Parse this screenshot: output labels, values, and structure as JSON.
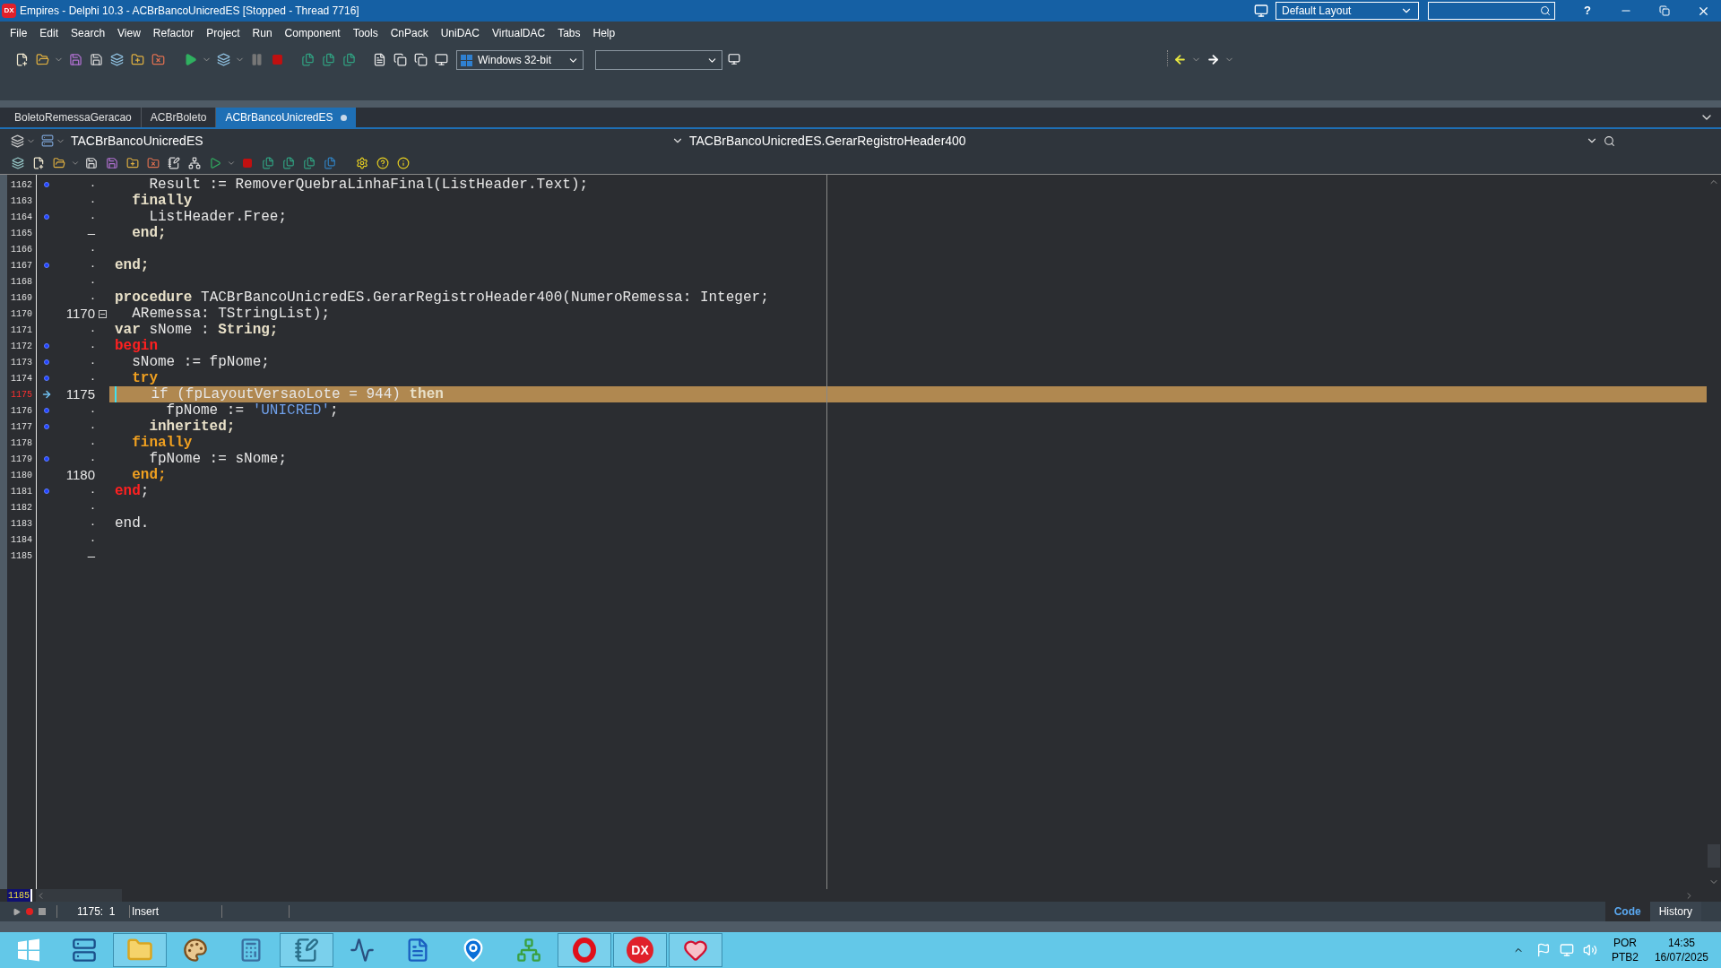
{
  "window": {
    "logo": "DX",
    "title": "Empires - Delphi 10.3 - ACBrBancoUnicredES [Stopped - Thread 7716]",
    "layout": "Default Layout",
    "help": "?"
  },
  "menu": [
    "File",
    "Edit",
    "Search",
    "View",
    "Refactor",
    "Project",
    "Run",
    "Component",
    "Tools",
    "CnPack",
    "UniDAC",
    "VirtualDAC",
    "Tabs",
    "Help"
  ],
  "toolbar": {
    "platform": "Windows 32-bit"
  },
  "tabs": [
    {
      "label": "BoletoRemessaGeracao",
      "selected": false,
      "modified": false
    },
    {
      "label": "ACBrBoleto",
      "selected": false,
      "modified": false
    },
    {
      "label": "ACBrBancoUnicredES",
      "selected": true,
      "modified": true
    }
  ],
  "editor": {
    "unit": "TACBrBancoUnicredES",
    "method": "TACBrBancoUnicredES.GerarRegistroHeader400",
    "lines": [
      {
        "number": "1162",
        "marker": "·",
        "dot": true,
        "fold": false,
        "current": false,
        "tokens": [
          {
            "t": "    Result := RemoverQuebraLinhaFinal(ListHeader.Text);",
            "kind": "text"
          }
        ]
      },
      {
        "number": "1163",
        "marker": "·",
        "dot": false,
        "fold": false,
        "current": false,
        "tokens": [
          {
            "t": "  finally",
            "kind": "kw"
          }
        ]
      },
      {
        "number": "1164",
        "marker": "·",
        "dot": true,
        "fold": false,
        "current": false,
        "tokens": [
          {
            "t": "    ListHeader.Free;",
            "kind": "text"
          }
        ]
      },
      {
        "number": "1165",
        "marker": "–",
        "dot": false,
        "fold": false,
        "current": false,
        "tokens": [
          {
            "t": "  end;",
            "kind": "kw"
          }
        ]
      },
      {
        "number": "1166",
        "marker": "·",
        "dot": false,
        "fold": false,
        "current": false
      },
      {
        "number": "1167",
        "marker": "·",
        "dot": true,
        "fold": false,
        "current": false,
        "tokens": [
          {
            "t": "end;",
            "kind": "kw"
          }
        ]
      },
      {
        "number": "1168",
        "marker": "·",
        "dot": false,
        "fold": false,
        "current": false
      },
      {
        "number": "1169",
        "marker": "·",
        "dot": false,
        "fold": false,
        "current": false,
        "tokens": [
          {
            "t": "procedure",
            "kind": "kw"
          },
          {
            "t": " TACBrBancoUnicredES.GerarRegistroHeader400(NumeroRemessa: Integer;",
            "kind": "text"
          }
        ]
      },
      {
        "number": "1170",
        "marker": "1170",
        "dot": false,
        "fold": true,
        "current": false,
        "tokens": [
          {
            "t": "  ARemessa: TStringList);",
            "kind": "text"
          }
        ]
      },
      {
        "number": "1171",
        "marker": "·",
        "dot": false,
        "fold": false,
        "current": false,
        "tokens": [
          {
            "t": "var",
            "kind": "kw"
          },
          {
            "t": " sNome : ",
            "kind": "text"
          },
          {
            "t": "String;",
            "kind": "kw"
          }
        ]
      },
      {
        "number": "1172",
        "marker": "·",
        "dot": true,
        "fold": false,
        "current": false,
        "tokens": [
          {
            "t": "begin",
            "kind": "kw_red"
          }
        ]
      },
      {
        "number": "1173",
        "marker": "·",
        "dot": true,
        "fold": false,
        "current": false,
        "tokens": [
          {
            "t": "  sNome := fpNome;",
            "kind": "text"
          }
        ]
      },
      {
        "number": "1174",
        "marker": "·",
        "dot": true,
        "fold": false,
        "current": false,
        "tokens": [
          {
            "t": "  try",
            "kind": "kw_orange"
          }
        ]
      },
      {
        "number": "1175",
        "marker": "1175",
        "dot": false,
        "fold": false,
        "current": true,
        "tokens": [
          {
            "t": "    if (fpLayoutVersaoLote = 944) ",
            "kind": "text"
          },
          {
            "t": "then",
            "kind": "kw"
          }
        ]
      },
      {
        "number": "1176",
        "marker": "·",
        "dot": true,
        "fold": false,
        "current": false,
        "tokens": [
          {
            "t": "      fpNome := ",
            "kind": "text"
          },
          {
            "t": "'UNICRED'",
            "kind": "string"
          },
          {
            "t": ";",
            "kind": "text"
          }
        ]
      },
      {
        "number": "1177",
        "marker": "·",
        "dot": true,
        "fold": false,
        "current": false,
        "tokens": [
          {
            "t": "    inherited;",
            "kind": "kw"
          }
        ]
      },
      {
        "number": "1178",
        "marker": "·",
        "dot": false,
        "fold": false,
        "current": false,
        "tokens": [
          {
            "t": "  finally",
            "kind": "kw_orange"
          }
        ]
      },
      {
        "number": "1179",
        "marker": "·",
        "dot": true,
        "fold": false,
        "current": false,
        "tokens": [
          {
            "t": "    fpNome := sNome;",
            "kind": "text"
          }
        ]
      },
      {
        "number": "1180",
        "marker": "1180",
        "dot": false,
        "fold": false,
        "current": false,
        "tokens": [
          {
            "t": "  end;",
            "kind": "kw_orange"
          }
        ]
      },
      {
        "number": "1181",
        "marker": "·",
        "dot": true,
        "fold": false,
        "current": false,
        "tokens": [
          {
            "t": "end",
            "kind": "kw_red"
          },
          {
            "t": ";",
            "kind": "text"
          }
        ]
      },
      {
        "number": "1182",
        "marker": "·",
        "dot": false,
        "fold": false,
        "current": false
      },
      {
        "number": "1183",
        "marker": "·",
        "dot": false,
        "fold": false,
        "current": false,
        "tokens": [
          {
            "t": "end.",
            "kind": "text"
          }
        ]
      },
      {
        "number": "1184",
        "marker": "·",
        "dot": false,
        "fold": false,
        "current": false
      },
      {
        "number": "1185",
        "marker": "–",
        "dot": false,
        "fold": false,
        "current": false
      }
    ],
    "last_line": "1185"
  },
  "status_bar": {
    "position": "1175:  1",
    "mode": "Insert",
    "views": [
      {
        "label": "Code",
        "selected": true
      },
      {
        "label": "History",
        "selected": false
      }
    ]
  },
  "taskbar": {
    "apps": [
      {
        "kind": "windows",
        "running": false
      },
      {
        "kind": "server",
        "running": false
      },
      {
        "kind": "folder",
        "running": true
      },
      {
        "kind": "paint",
        "running": false
      },
      {
        "kind": "calculator",
        "running": false
      },
      {
        "kind": "notepad",
        "running": true
      },
      {
        "kind": "monitor",
        "running": false
      },
      {
        "kind": "document",
        "running": false
      },
      {
        "kind": "pin",
        "running": false
      },
      {
        "kind": "network",
        "running": false
      },
      {
        "kind": "opera",
        "running": true
      },
      {
        "kind": "dx",
        "running": true,
        "label": "DX"
      },
      {
        "kind": "heart",
        "running": true
      }
    ],
    "language": "POR",
    "keyboard": "PTB2",
    "time": "14:35",
    "date": "16/07/2025"
  }
}
